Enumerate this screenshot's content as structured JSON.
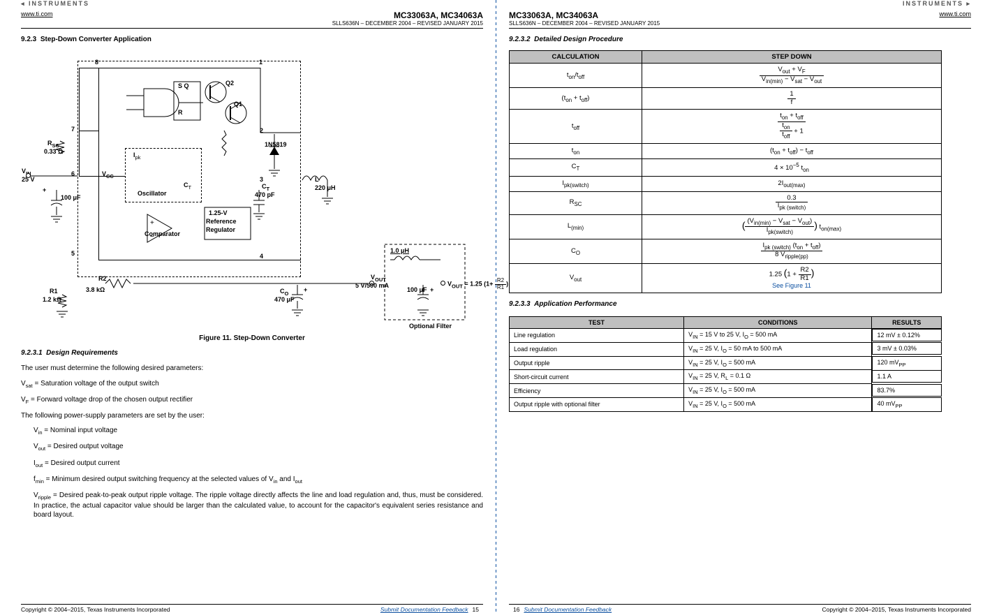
{
  "brand": "INSTRUMENTS",
  "web": "www.ti.com",
  "part": "MC33063A, MC34063A",
  "doccode": "SLLS636N – DECEMBER 2004 – REVISED JANUARY 2015",
  "left": {
    "sec_num": "9.2.3",
    "sec_title": "Step-Down Converter Application",
    "figcap": "Figure 11.  Step-Down Converter",
    "reqs_num": "9.2.3.1",
    "reqs_title": "Design Requirements",
    "p1": "The user must determine the following desired parameters:",
    "vs_label": "V",
    "vs_sub": "sat",
    "vs_txt": " = Saturation voltage of the output switch",
    "vf_label": "V",
    "vf_sub": "F",
    "vf_txt": " = Forward voltage drop of the chosen output rectifier",
    "p2": "The following power-supply parameters are set by the user:",
    "vin_l": "V",
    "vin_s": "in",
    "vin_t": " = Nominal input voltage",
    "vout_l": "V",
    "vout_s": "out",
    "vout_t": " = Desired output voltage",
    "iout_l": "I",
    "iout_s": "out",
    "iout_t": " = Desired output current",
    "fmin_l": "f",
    "fmin_s": "min",
    "fmin_t": " = Minimum desired output switching frequency at the selected values of V",
    "fmin_s2": "in",
    "fmin_t2": " and I",
    "fmin_s3": "out",
    "vrip_l": "V",
    "vrip_s": "ripple",
    "vrip_t": " = Desired peak-to-peak output ripple voltage. The ripple voltage directly affects the line and load regulation and, thus, must be considered. In practice, the actual capacitor value should be larger than the calculated value, to account for the capacitor's equivalent series resistance and board layout.",
    "schem": {
      "pins": {
        "p1": "1",
        "p2": "2",
        "p3": "3",
        "p4": "4",
        "p5": "5",
        "p6": "6",
        "p7": "7",
        "p8": "8"
      },
      "q1": "Q1",
      "q2": "Q2",
      "sq": "S   Q",
      "r": "R",
      "vin": "V",
      "vin_sub": "IN",
      "vin_val": "25 V",
      "rsc": "R",
      "rsc_sub": "SC",
      "rsc_val": "0.33 Ω",
      "ipk": "I",
      "ipk_sub": "pk",
      "osc": "Oscillator",
      "ct": "C",
      "ct_sub": "T",
      "ctv": "470 pF",
      "vcc": "V",
      "vcc_sub": "CC",
      "c100": "100 μF",
      "ref1": "1.25-V",
      "ref2": "Reference",
      "ref3": "Regulator",
      "comp": "Comparator",
      "r1": "R1",
      "r1v": "1.2 kΩ",
      "r2": "R2",
      "r2v": "3.8 kΩ",
      "co": "C",
      "co_sub": "O",
      "cov": "470 μF",
      "diode": "1N5819",
      "l": "L",
      "lv": "220 μH",
      "voutl": "V",
      "vouts": "OUT",
      "voutv": "5 V/500 mA",
      "filt": "1.0 μH",
      "filtc": "100 μF",
      "eq": "V",
      "eq_sub": "OUT",
      "eq_t": " = 1.25 (1+ ",
      "eq_num": "R2",
      "eq_den": "R1",
      "eq_close": ")",
      "opt": "Optional Filter"
    }
  },
  "right": {
    "proc_num": "9.2.3.2",
    "proc_title": "Detailed Design Procedure",
    "tbl_h1": "CALCULATION",
    "tbl_h2": "STEP DOWN",
    "rows": [
      {
        "lab_html": "t<sub>on</sub>/t<sub>off</sub>",
        "val_html": "<span class='frac'><span class='num'>V<sub>out</sub> + V<sub>F</sub></span><span class='den'>V<sub>in(min)</sub> − V<sub>sat</sub> − V<sub>out</sub></span></span>"
      },
      {
        "lab_html": "(t<sub>on</sub> + t<sub>off</sub>)",
        "val_html": "<span class='frac'><span class='num'>1</span><span class='den'>f</span></span>"
      },
      {
        "lab_html": "t<sub>off</sub>",
        "val_html": "<span class='frac'><span class='num'>t<sub>on</sub> + t<sub>off</sub></span><span class='den'><span class='frac'><span class='num'>t<sub>on</sub></span><span class='den'>t<sub>off</sub></span></span> + 1</span></span>"
      },
      {
        "lab_html": "t<sub>on</sub>",
        "val_html": "(t<sub>on</sub> + t<sub>off</sub>) − t<sub>off</sub>"
      },
      {
        "lab_html": "C<sub>T</sub>",
        "val_html": "4 × 10<sup>−5</sup> t<sub>on</sub>"
      },
      {
        "lab_html": "I<sub>pk(switch)</sub>",
        "val_html": "2I<sub>out(max)</sub>"
      },
      {
        "lab_html": "R<sub>SC</sub>",
        "val_html": "<span class='frac'><span class='num'>0.3</span><span class='den'>I<sub>pk (switch)</sub></span></span>"
      },
      {
        "lab_html": "L<sub>(min)</sub>",
        "val_html": "<span style='font-size:14px'>(</span><span class='frac'><span class='num'>(V<sub>in(min)</sub> − V<sub>sat</sub> − V<sub>out</sub>)</span><span class='den'>I<sub>pk(switch)</sub></span></span><span style='font-size:14px'>)</span> t<sub>on(max)</sub>"
      },
      {
        "lab_html": "C<sub>O</sub>",
        "val_html": "<span class='frac'><span class='num'>I<sub>pk (switch)</sub> (t<sub>on</sub> + t<sub>off</sub>)</span><span class='den'>8 V<sub>ripple(pp)</sub></span></span>"
      },
      {
        "lab_html": "V<sub>out</sub>",
        "val_html": "1.25 <span style='font-size:14px'>(</span>1 + <span class='frac'><span class='num'>R2</span><span class='den'>R1</span></span><span style='font-size:14px'>)</span><br><span class='seefig'>See Figure 11</span>"
      }
    ],
    "perf_num": "9.2.3.3",
    "perf_title": "Application Performance",
    "ph1": "TEST",
    "ph2": "CONDITIONS",
    "ph3": "RESULTS",
    "perf": [
      {
        "t": "Line regulation",
        "c": "V<sub>IN</sub> = 15 V to 25 V, I<sub>O</sub> = 500 mA",
        "r": "12 mV ± 0.12%"
      },
      {
        "t": "Load regulation",
        "c": "V<sub>IN</sub> = 25 V, I<sub>O</sub> = 50 mA to 500 mA",
        "r": "3 mV ± 0.03%"
      },
      {
        "t": "Output ripple",
        "c": "V<sub>IN</sub> = 25 V, I<sub>O</sub> = 500 mA",
        "r": "120 mV<sub>PP</sub>"
      },
      {
        "t": "Short-circuit current",
        "c": "V<sub>IN</sub> = 25 V, R<sub>L</sub> = 0.1 Ω",
        "r": "1.1 A"
      },
      {
        "t": "Efficiency",
        "c": "V<sub>IN</sub> = 25 V, I<sub>O</sub> = 500 mA",
        "r": "83.7%"
      },
      {
        "t": "Output ripple with optional filter",
        "c": "V<sub>IN</sub> = 25 V, I<sub>O</sub> = 500 mA",
        "r": "40 mV<sub>PP</sub>"
      }
    ]
  },
  "footer": {
    "copyright": "Copyright © 2004–2015, Texas Instruments Incorporated",
    "feedback": "Submit Documentation Feedback",
    "p15": "15",
    "p16": "16"
  }
}
